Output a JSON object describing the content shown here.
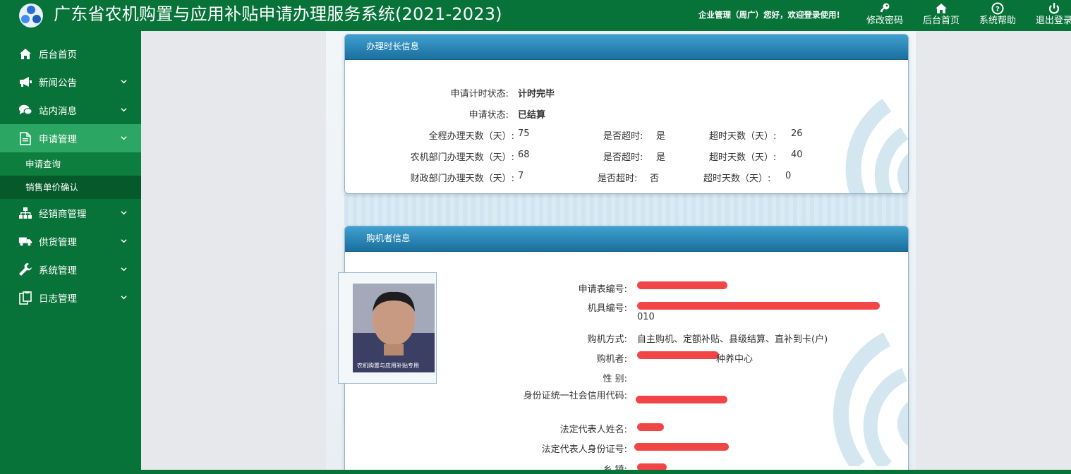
{
  "header": {
    "title": "广东省农机购置与应用补贴申请办理服务系统(2021-2023)",
    "welcome": "企业管理（周广）您好，欢迎登录使用!",
    "actions": [
      {
        "label": "修改密码",
        "icon": "key-icon"
      },
      {
        "label": "后台首页",
        "icon": "home-icon"
      },
      {
        "label": "系统帮助",
        "icon": "help-icon"
      },
      {
        "label": "退出登录",
        "icon": "power-icon"
      }
    ]
  },
  "sidebar": {
    "items": [
      {
        "label": "后台首页",
        "icon": "home-icon"
      },
      {
        "label": "新闻公告",
        "icon": "megaphone-icon"
      },
      {
        "label": "站内消息",
        "icon": "chat-icon"
      },
      {
        "label": "申请管理",
        "icon": "document-icon"
      },
      {
        "label": "经销商管理",
        "icon": "sitemap-icon"
      },
      {
        "label": "供货管理",
        "icon": "truck-icon"
      },
      {
        "label": "系统管理",
        "icon": "wrench-icon"
      },
      {
        "label": "日志管理",
        "icon": "clipboard-icon"
      }
    ],
    "sub_items": [
      "申请查询",
      "销售单价确认"
    ]
  },
  "panel_duration": {
    "title": "办理时长信息",
    "timer_status_label": "申请计时状态:",
    "timer_status_value": "计时完毕",
    "status_label": "申请状态:",
    "status_value": "已结算",
    "rows": [
      {
        "label": "全程办理天数（天）:",
        "days": "75",
        "overdue_label": "是否超时:",
        "overdue": "是",
        "over_days_label": "超时天数（天）:",
        "over_days": "26"
      },
      {
        "label": "农机部门办理天数（天）:",
        "days": "68",
        "overdue_label": "是否超时:",
        "overdue": "是",
        "over_days_label": "超时天数（天）:",
        "over_days": "40"
      },
      {
        "label": "财政部门办理天数（天）:",
        "days": "7",
        "overdue_label": "是否超时:",
        "overdue": "否",
        "over_days_label": "超时天数（天）:",
        "over_days": "0"
      }
    ]
  },
  "panel_buyer": {
    "title": "购机者信息",
    "photo_caption": "农机购置与应用补贴专用",
    "fields": {
      "form_no_label": "申请表编号:",
      "machine_no_label": "机具编号:",
      "machine_no_tail": "010",
      "method_label": "购机方式:",
      "method_value": "自主购机、定额补贴、县级结算、直补到卡(户)",
      "buyer_label": "购机者:",
      "buyer_value_visible": "种养中心",
      "gender_label": "性  别:",
      "id_label": "身份证统一社会信用代码:",
      "legal_name_label": "法定代表人姓名:",
      "legal_id_label": "法定代表人身份证号:",
      "town_label": "乡  镇:"
    }
  },
  "colors": {
    "header_green": "#087339",
    "active_green": "#2ba763",
    "panel_blue": "#2a86b8",
    "redaction": "#f24646"
  }
}
